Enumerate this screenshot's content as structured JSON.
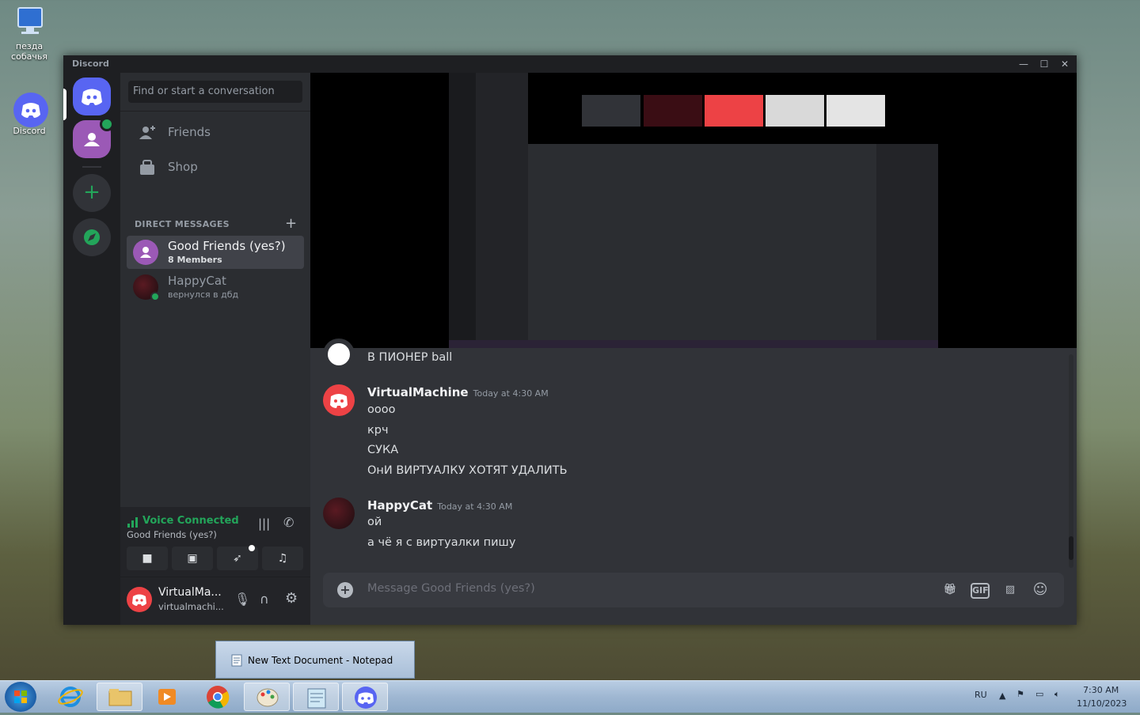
{
  "desktop": {
    "icons": [
      {
        "label": "пезда собачья",
        "icon": "computer-icon"
      },
      {
        "label": "Discord",
        "icon": "discord-icon"
      }
    ]
  },
  "window": {
    "title": "Discord",
    "controls": [
      "minimize-icon",
      "maximize-icon",
      "close-icon"
    ]
  },
  "sidebar": {
    "search_placeholder": "Find or start a conversation",
    "nav": [
      {
        "label": "Friends",
        "icon": "friends-icon"
      },
      {
        "label": "Shop",
        "icon": "shop-icon"
      }
    ],
    "dm_header": "DIRECT MESSAGES",
    "dms": [
      {
        "name": "Good Friends (yes?)",
        "sub": "8 Members",
        "selected": true
      },
      {
        "name": "HappyCat",
        "sub": "вернулся в дбд",
        "selected": false
      }
    ],
    "voice": {
      "status": "Voice Connected",
      "channel": "Good Friends (yes?)"
    },
    "user": {
      "name": "VirtualMa...",
      "tag": "virtualmachi..."
    }
  },
  "chat": {
    "partial_message": "В ПИОНЕР ball",
    "messages": [
      {
        "author": "VirtualMachine",
        "time": "Today at 4:30 AM",
        "lines": [
          "оооо",
          "крч",
          "СУКА",
          "ОнИ ВИРТУАЛКУ ХОТЯТ УДАЛИТЬ"
        ]
      },
      {
        "author": "HappyCat",
        "time": "Today at 4:30 AM",
        "lines": [
          "ой",
          "а чё я с виртуалки пишу"
        ]
      }
    ],
    "composer_placeholder": "Message Good Friends (yes?)",
    "gif_label": "GIF"
  },
  "taskbar": {
    "popup": "New Text Document - Notepad",
    "lang": "RU",
    "time": "7:30 AM",
    "date": "11/10/2023"
  },
  "colors": {
    "blurple": "#5865f2",
    "green": "#23a55a",
    "purple": "#9b59b6",
    "red": "#ed4245"
  }
}
